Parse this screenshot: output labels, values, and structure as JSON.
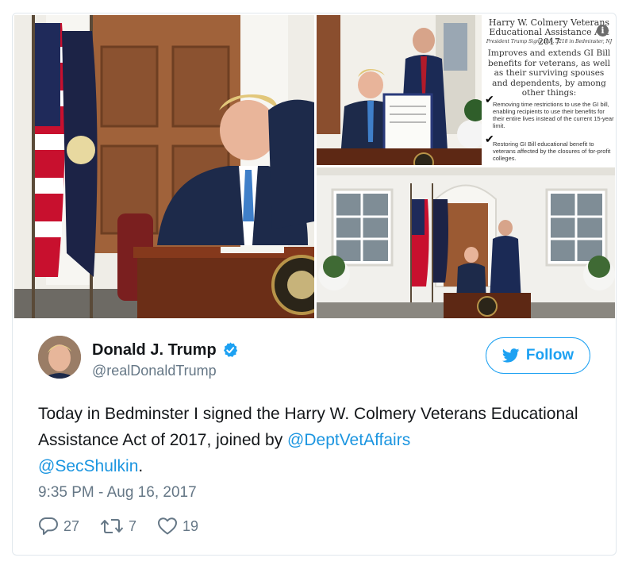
{
  "media": {
    "infographic": {
      "title": "Harry W. Colmery Veterans Educational Assistance Act 2017",
      "subtitle": "President Trump Signs H.R. 3218 in Bedminster, NJ",
      "lead": "Improves and extends GI Bill benefits for veterans, as well as their surviving spouses and dependents, by among other things:",
      "items": [
        "Removing time restrictions to use the GI bill, enabling recipients to use their benefits for their entire lives instead of the current 15-year limit.",
        "Restoring GI Bill educational benefit to veterans affected by the closures of for-profit colleges."
      ],
      "info_icon": "info-icon"
    }
  },
  "user": {
    "name": "Donald J. Trump",
    "handle": "@realDonaldTrump",
    "verified_icon": "verified-badge-icon"
  },
  "follow_button": {
    "label": "Follow",
    "icon": "twitter-bird-icon"
  },
  "tweet": {
    "text_before": "Today in Bedminster I signed the Harry W. Colmery Veterans Educational Assistance Act of 2017, joined by ",
    "mention_1": "@DeptVetAffairs",
    "mention_2": "@SecShulkin",
    "text_after": ".",
    "timestamp": "9:35 PM - Aug 16, 2017"
  },
  "actions": {
    "replies": "27",
    "retweets": "7",
    "likes": "19"
  },
  "colors": {
    "accent": "#1da1f2",
    "link": "#1b95e0",
    "muted": "#657786",
    "text": "#14171a",
    "border": "#e1e8ed"
  }
}
